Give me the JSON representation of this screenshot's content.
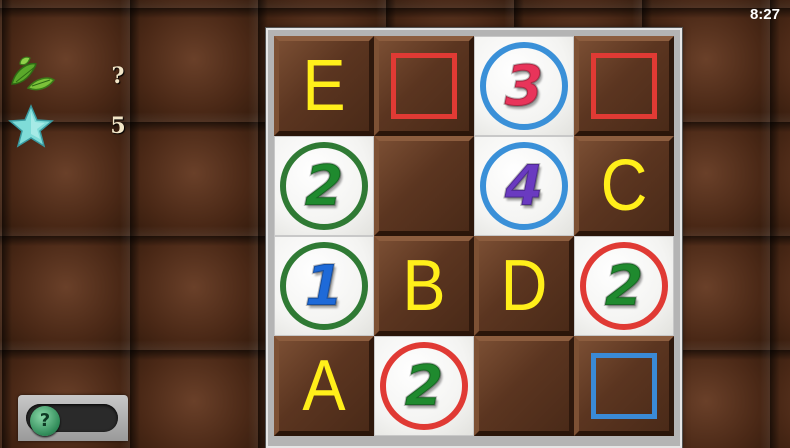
{
  "status_bar": {
    "time": "8:27"
  },
  "sidebar": {
    "leaves": {
      "icon": "leaf-icon",
      "value": "?"
    },
    "stars": {
      "icon": "star-icon",
      "value": "5"
    },
    "hint": {
      "icon": "help-icon",
      "knob_label": "?"
    }
  },
  "colors": {
    "red": "#e03a34",
    "green": "#2f7a34",
    "blue": "#3a90d8",
    "yellow_letter": "#ffef1a",
    "num_red": "#e8345a",
    "num_green": "#1f8a2e",
    "num_purple": "#6a3ac0",
    "num_blue": "#1e6ad8"
  },
  "board": {
    "rows": [
      [
        {
          "tile": "chocolate",
          "letter": "E"
        },
        {
          "tile": "chocolate",
          "square": "red"
        },
        {
          "tile": "white",
          "ring": "blue",
          "number": "3",
          "number_color": "red"
        },
        {
          "tile": "chocolate",
          "square": "red"
        }
      ],
      [
        {
          "tile": "white",
          "ring": "green",
          "number": "2",
          "number_color": "green"
        },
        {
          "tile": "chocolate"
        },
        {
          "tile": "white",
          "ring": "blue",
          "number": "4",
          "number_color": "purple"
        },
        {
          "tile": "chocolate",
          "letter": "C"
        }
      ],
      [
        {
          "tile": "white",
          "ring": "green",
          "number": "1",
          "number_color": "blue"
        },
        {
          "tile": "chocolate",
          "letter": "B"
        },
        {
          "tile": "chocolate",
          "letter": "D"
        },
        {
          "tile": "white",
          "ring": "red",
          "number": "2",
          "number_color": "green"
        }
      ],
      [
        {
          "tile": "chocolate",
          "letter": "A"
        },
        {
          "tile": "white",
          "ring": "red",
          "number": "2",
          "number_color": "green"
        },
        {
          "tile": "chocolate"
        },
        {
          "tile": "chocolate",
          "square": "blue"
        }
      ]
    ]
  }
}
